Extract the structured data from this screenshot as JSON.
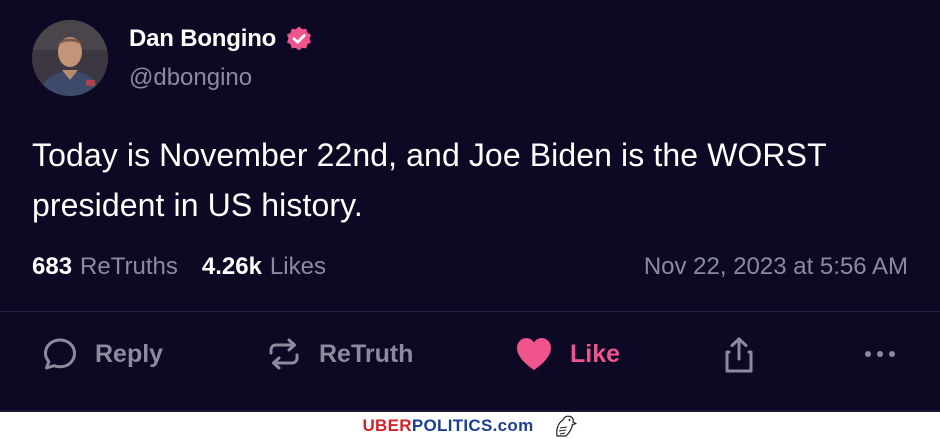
{
  "post": {
    "author": {
      "display_name": "Dan Bongino",
      "handle": "@dbongino",
      "verified": true
    },
    "text": "Today is November 22nd, and Joe Biden is the WORST president in US history.",
    "stats": {
      "retruths_count": "683",
      "retruths_label": "ReTruths",
      "likes_count": "4.26k",
      "likes_label": "Likes"
    },
    "timestamp": "Nov 22, 2023 at 5:56 AM",
    "actions": {
      "reply": "Reply",
      "retruth": "ReTruth",
      "like": "Like"
    },
    "icons": {
      "verified": "verified-badge-icon",
      "reply": "speech-bubble-icon",
      "retruth": "repost-arrows-icon",
      "like": "heart-icon",
      "share": "share-icon",
      "more": "more-dots-icon"
    }
  },
  "colors": {
    "background": "#0d0824",
    "accent": "#f0548c",
    "muted_text": "#8d8a9e"
  },
  "watermark": {
    "part1": "UBER",
    "part2": "POLITICS",
    "part3": ".com"
  }
}
